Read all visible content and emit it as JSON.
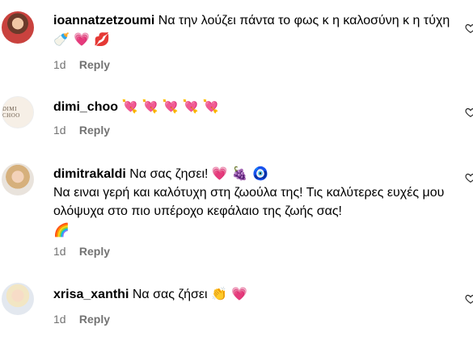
{
  "comments": [
    {
      "username": "ioannatzetzoumi",
      "text": "Να την λούζει πάντα το φως κ η καλοσύνη κ η τύχη",
      "emoji": "🍼 💗 💋",
      "time": "1d",
      "reply_label": "Reply",
      "avatar_icon": "user-avatar"
    },
    {
      "username": "dimi_choo",
      "text": "",
      "emoji": "💘 💘 💘 💘 💘",
      "time": "1d",
      "reply_label": "Reply",
      "avatar_text": "DIMI CHOO"
    },
    {
      "username": "dimitrakaldi",
      "text": "Να σας ζησει!",
      "emoji": "💗 🍇 🧿",
      "text2": "Να ειναι γερή και καλότυχη στη ζωούλα της! Τις καλύτερες ευχές μου ολόψυχα στο πιο υπέροχο κεφάλαιο της ζωής σας!",
      "emoji2": "🌈",
      "time": "1d",
      "reply_label": "Reply"
    },
    {
      "username": "xrisa_xanthi",
      "text": "Να σας ζήσει",
      "emoji": "👏 💗",
      "time": "1d",
      "reply_label": "Reply"
    }
  ]
}
